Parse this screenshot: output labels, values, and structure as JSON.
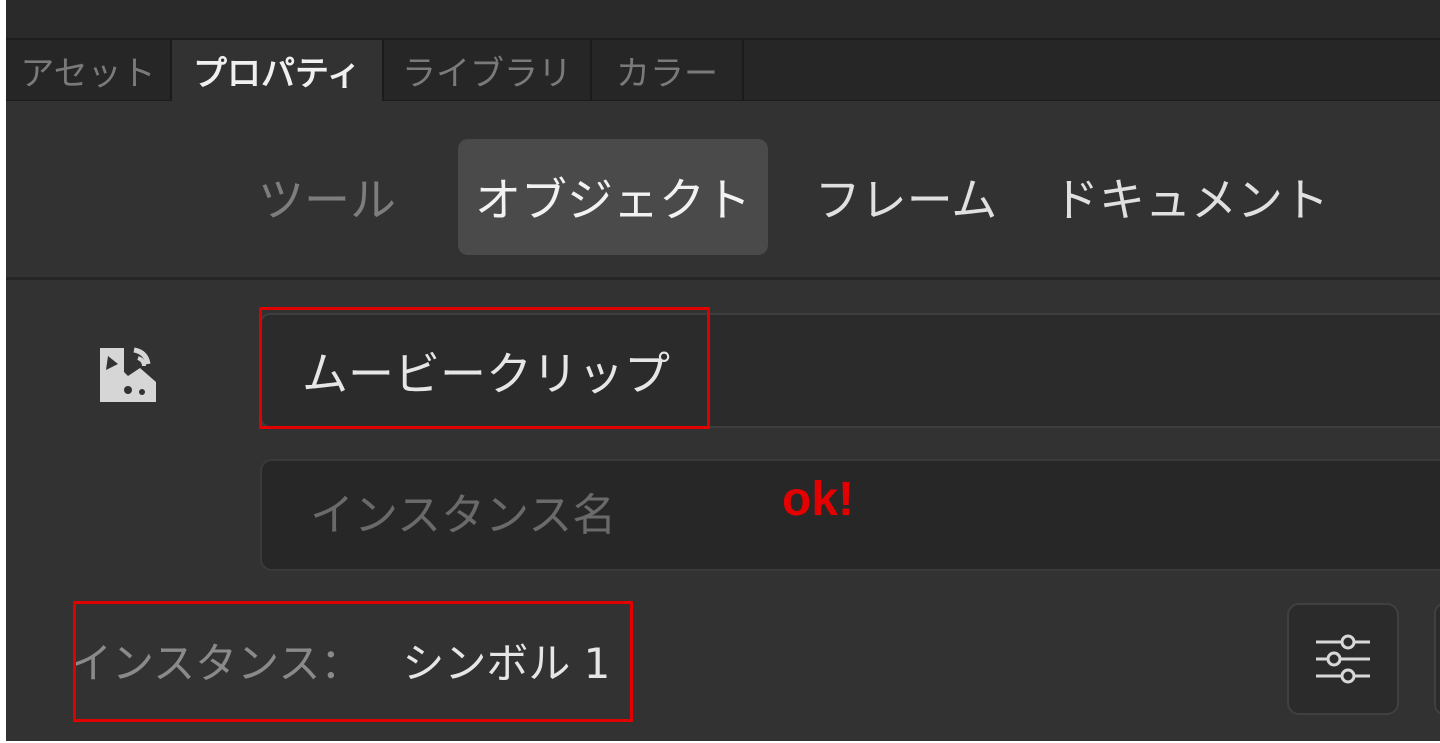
{
  "panel_tabs": [
    {
      "label": "アセット",
      "active": false
    },
    {
      "label": "プロパティ",
      "active": true
    },
    {
      "label": "ライブラリ",
      "active": false
    },
    {
      "label": "カラー",
      "active": false
    }
  ],
  "sub_tabs": [
    {
      "label": "ツール",
      "active": false
    },
    {
      "label": "オブジェクト",
      "active": true
    },
    {
      "label": "フレーム",
      "active": false
    },
    {
      "label": "ドキュメント",
      "active": false
    }
  ],
  "symbol": {
    "icon": "movie-clip-symbol-icon",
    "type_value": "ムービークリップ"
  },
  "instance_name": {
    "placeholder": "インスタンス名",
    "value": ""
  },
  "instance": {
    "label": "インスタンス：",
    "value": "シンボル 1"
  },
  "annotation": {
    "note": "ok!",
    "color": "#e00000"
  },
  "settings_button": {
    "icon": "sliders-icon"
  },
  "colors": {
    "panel_bg": "#323232",
    "tab_strip_bg": "#262626",
    "active_subtab_bg": "#4a4a4a"
  }
}
